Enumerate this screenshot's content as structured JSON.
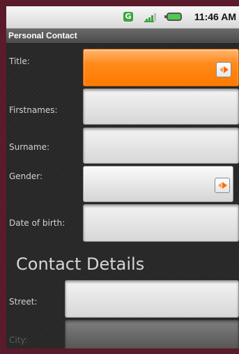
{
  "status_bar": {
    "icons": [
      "g-app-icon",
      "signal-icon",
      "battery-icon"
    ],
    "g_glyph": "G",
    "time": "11:46 AM"
  },
  "title_bar": {
    "title": "Personal Contact"
  },
  "form": {
    "title": {
      "label": "Title:",
      "value": ""
    },
    "firstnames": {
      "label": "Firstnames:",
      "value": ""
    },
    "surname": {
      "label": "Surname:",
      "value": ""
    },
    "gender": {
      "label": "Gender:",
      "value": ""
    },
    "date_of_birth": {
      "label": "Date of birth:",
      "value": ""
    }
  },
  "contact_details": {
    "heading": "Contact Details",
    "street": {
      "label": "Street:",
      "value": ""
    },
    "city": {
      "label": "City:",
      "value": ""
    }
  },
  "colors": {
    "accent_focus": "#ff8a1a",
    "status_green": "#3aa53a",
    "device_frame": "#5a1b2b"
  }
}
